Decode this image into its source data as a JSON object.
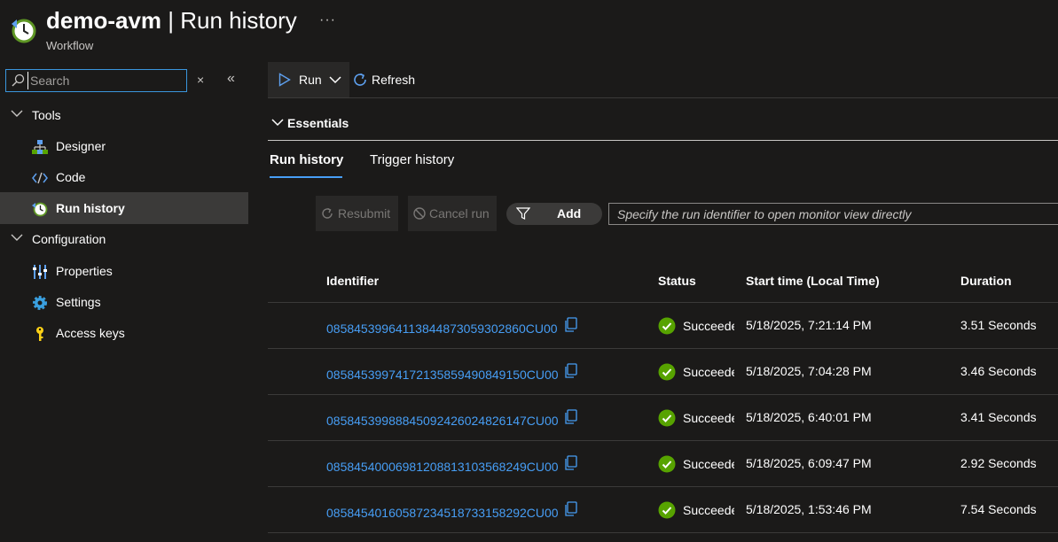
{
  "header": {
    "resource_name": "demo-avm",
    "separator": " | ",
    "page_title": "Run history",
    "subtitle": "Workflow",
    "more_label": "···"
  },
  "sidebar": {
    "search_placeholder": "Search",
    "clear_label": "×",
    "collapse_label": "«",
    "groups": [
      {
        "label": "Tools"
      },
      {
        "label": "Configuration"
      }
    ],
    "items": [
      {
        "label": "Designer",
        "icon": "designer-icon"
      },
      {
        "label": "Code",
        "icon": "code-icon"
      },
      {
        "label": "Run history",
        "icon": "clock-icon",
        "active": true
      },
      {
        "label": "Properties",
        "icon": "properties-icon"
      },
      {
        "label": "Settings",
        "icon": "gear-icon"
      },
      {
        "label": "Access keys",
        "icon": "key-icon"
      }
    ]
  },
  "toolbar": {
    "run_label": "Run",
    "refresh_label": "Refresh"
  },
  "essentials": {
    "label": "Essentials"
  },
  "tabs": [
    {
      "label": "Run history",
      "active": true
    },
    {
      "label": "Trigger history",
      "active": false
    }
  ],
  "actions": {
    "resubmit_label": "Resubmit",
    "cancel_label": "Cancel run",
    "add_filter_label": "Add",
    "run_id_placeholder": "Specify the run identifier to open monitor view directly"
  },
  "table": {
    "columns": [
      "Identifier",
      "Status",
      "Start time (Local Time)",
      "Duration"
    ],
    "rows": [
      {
        "identifier": "08584539964113844873059302860CU00",
        "status": "Succeeded",
        "start": "5/18/2025, 7:21:14 PM",
        "duration": "3.51 Seconds"
      },
      {
        "identifier": "08584539974172135859490849150CU00",
        "status": "Succeeded",
        "start": "5/18/2025, 7:04:28 PM",
        "duration": "3.46 Seconds"
      },
      {
        "identifier": "08584539988845092426024826147CU00",
        "status": "Succeeded",
        "start": "5/18/2025, 6:40:01 PM",
        "duration": "3.41 Seconds"
      },
      {
        "identifier": "08584540006981208813103568249CU00",
        "status": "Succeeded",
        "start": "5/18/2025, 6:09:47 PM",
        "duration": "2.92 Seconds"
      },
      {
        "identifier": "08584540160587234518733158292CU00",
        "status": "Succeeded",
        "start": "5/18/2025, 1:53:46 PM",
        "duration": "7.54 Seconds"
      }
    ]
  },
  "colors": {
    "background": "#1b1a19",
    "accent": "#479ef5",
    "success": "#57a300",
    "active_nav": "#3b3a39"
  }
}
